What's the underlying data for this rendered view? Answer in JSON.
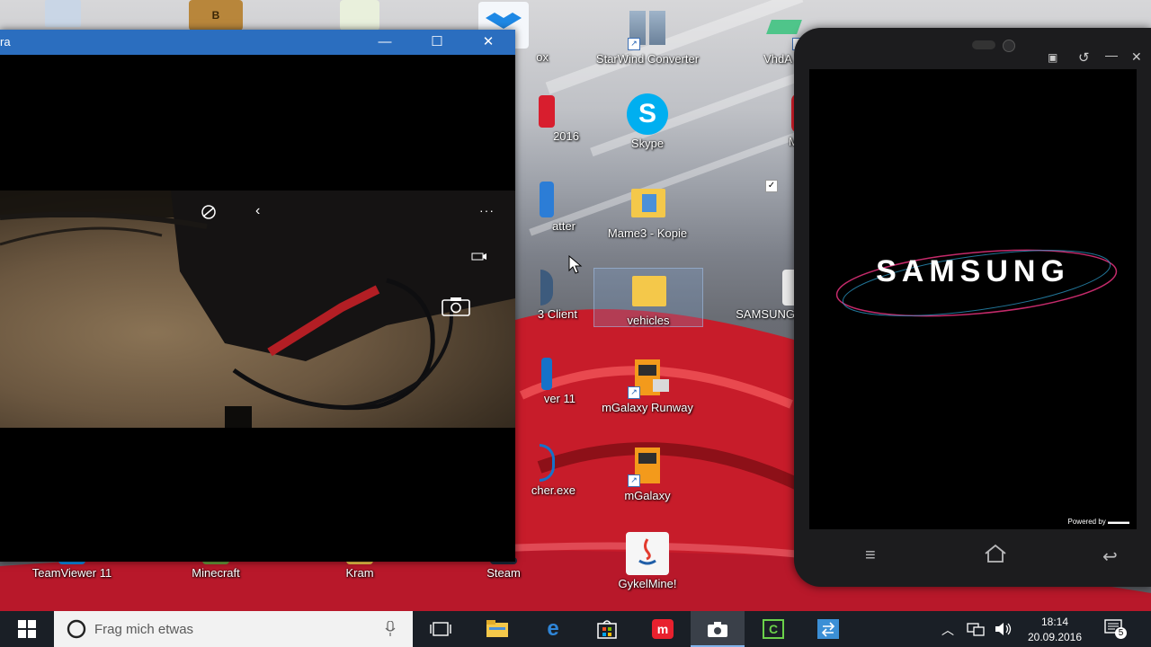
{
  "desktop": {
    "icons": [
      {
        "label": "StarWind Converter"
      },
      {
        "label": "VhdA"
      },
      {
        "label": "Skype"
      },
      {
        "label": "Mo"
      },
      {
        "label": "Mame3 - Kopie"
      },
      {
        "label": "vehicles"
      },
      {
        "label": "SAMSUNG"
      },
      {
        "label": "mGalaxy Runway"
      },
      {
        "label": "mGalaxy"
      },
      {
        "label": "GykelMine!"
      },
      {
        "label": "TeamViewer 11"
      },
      {
        "label": "Minecraft"
      },
      {
        "label": "Kram"
      },
      {
        "label": "Steam"
      },
      {
        "label": "ox"
      },
      {
        "label": "2016"
      },
      {
        "label": "atter"
      },
      {
        "label": "3 Client"
      },
      {
        "label": "ver 11"
      },
      {
        "label": "cher.exe"
      }
    ]
  },
  "camera_window": {
    "title": "ra",
    "controls": {
      "minimize": "—",
      "maximize": "☐",
      "close": "✕"
    }
  },
  "phone": {
    "boot_logo": "SAMSUNG",
    "powered_by": "Powered by"
  },
  "taskbar": {
    "search_placeholder": "Frag mich etwas",
    "time": "18:14",
    "date": "20.09.2016",
    "notification_count": "5"
  },
  "colors": {
    "titlebar": "#2b6ebf",
    "taskbar": "#1a1f26",
    "search_box": "#f2f2f2"
  }
}
